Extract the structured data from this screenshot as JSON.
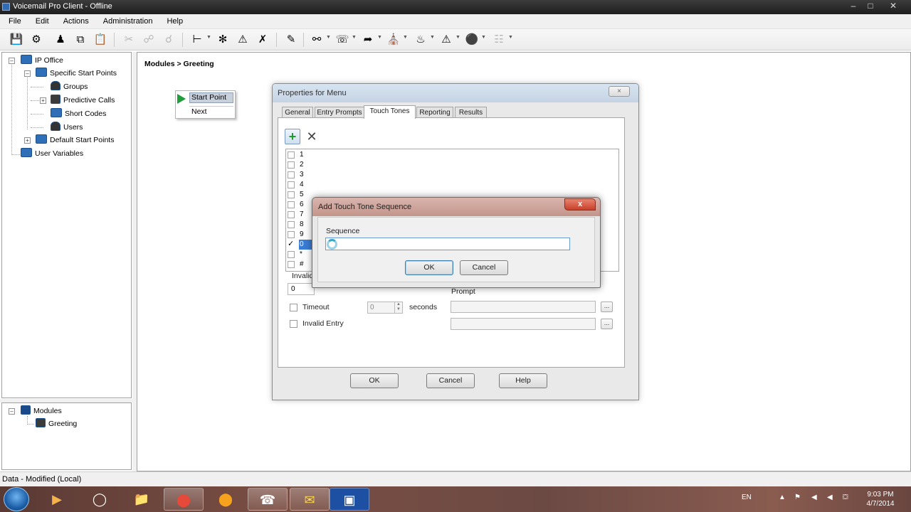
{
  "window": {
    "title": "Voicemail Pro Client - Offline"
  },
  "menu": [
    "File",
    "Edit",
    "Actions",
    "Administration",
    "Help"
  ],
  "tree": {
    "root": "IP Office",
    "specific": "Specific Start Points",
    "groups": "Groups",
    "predictive": "Predictive Calls",
    "shortcodes": "Short Codes",
    "users": "Users",
    "default": "Default Start Points",
    "uservars": "User Variables"
  },
  "modules": {
    "root": "Modules",
    "greeting": "Greeting"
  },
  "breadcrumb": "Modules > Greeting",
  "flow": {
    "start_point": "Start Point",
    "next": "Next"
  },
  "props": {
    "title": "Properties for Menu",
    "close": "×",
    "tabs": [
      "General",
      "Entry Prompts",
      "Touch Tones",
      "Reporting",
      "Results"
    ],
    "tones": [
      "1",
      "2",
      "3",
      "4",
      "5",
      "6",
      "7",
      "8",
      "9",
      "0",
      "*",
      "#"
    ],
    "selected_tone": "0",
    "check_mark": "✓",
    "invalid_label": "Invalid",
    "invalid_value": "0",
    "prompt_label": "Prompt",
    "timeout_label": "Timeout",
    "timeout_value": "0",
    "seconds_label": "seconds",
    "invalid_entry_label": "Invalid Entry",
    "ellipsis": "...",
    "ok": "OK",
    "cancel": "Cancel",
    "help": "Help"
  },
  "seq_dialog": {
    "title": "Add Touch Tone Sequence",
    "close": "x",
    "label": "Sequence",
    "value": "",
    "ok": "OK",
    "cancel": "Cancel"
  },
  "status": "Data - Modified (Local)",
  "taskbar": {
    "lang": "EN",
    "time": "9:03 PM",
    "date": "4/7/2014"
  }
}
